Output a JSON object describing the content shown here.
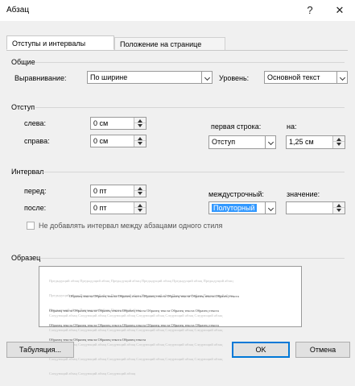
{
  "window": {
    "title": "Абзац",
    "help": "?",
    "close": "✕"
  },
  "tabs": [
    {
      "label": "Отступы и интервалы"
    },
    {
      "label": "Положение на странице"
    }
  ],
  "general": {
    "header": "Общие",
    "alignment_label": "Выравнивание:",
    "alignment_value": "По ширине",
    "level_label": "Уровень:",
    "level_value": "Основной текст"
  },
  "indent": {
    "header": "Отступ",
    "left_label": "слева:",
    "left_value": "0 см",
    "right_label": "справа:",
    "right_value": "0 см",
    "first_line_label": "первая строка:",
    "first_line_value": "Отступ",
    "by_label": "на:",
    "by_value": "1,25 см"
  },
  "spacing": {
    "header": "Интервал",
    "before_label": "перед:",
    "before_value": "0 пт",
    "after_label": "после:",
    "after_value": "0 пт",
    "line_spacing_label": "междустрочный:",
    "line_spacing_value": "Полуторный",
    "at_label": "значение:",
    "at_value": "",
    "dont_add_label": "Не добавлять интервал между абзацами одного стиля",
    "dont_add_checked": false
  },
  "preview": {
    "header": "Образец",
    "prev_lines": [
      "Предыдущий абзац Предыдущий абзац Предыдущий абзац Предыдущий абзац Предыдущий абзац Предыдущий абзац",
      "Предыдущий абзац Предыдущий абзац Предыдущий абзац Предыдущий абзац Предыдущий абзац Предыдущий абзац",
      "Предыдущий абзац Предыдущий абзац Предыдущий абзац"
    ],
    "sample_lines": [
      "Образец текста Образец текста Образец текста Образец текста Образец текста Образец текста Образец текста",
      "Образец текста Образец текста Образец текста Образец текста Образец текста Образец текста Образец текста",
      "Образец текста Образец текста Образец текста Образец текста Образец текста Образец текста Образец текста",
      "Образец текста Образец текста Образец текста Образец текста"
    ],
    "next_lines": [
      "Следующий абзац Следующий абзац Следующий абзац Следующий абзац Следующий абзац Следующий абзац",
      "Следующий абзац Следующий абзац Следующий абзац Следующий абзац Следующий абзац Следующий абзац",
      "Следующий абзац Следующий абзац Следующий абзац Следующий абзац Следующий абзац Следующий абзац",
      "Следующий абзац Следующий абзац Следующий абзац Следующий абзац Следующий абзац Следующий абзац",
      "Следующий абзац Следующий абзац Следующий абзац"
    ]
  },
  "buttons": {
    "tabs": "Табуляция...",
    "ok": "OK",
    "cancel": "Отмена"
  },
  "colors": {
    "accent": "#0078d7",
    "selection": "#3399ff"
  }
}
